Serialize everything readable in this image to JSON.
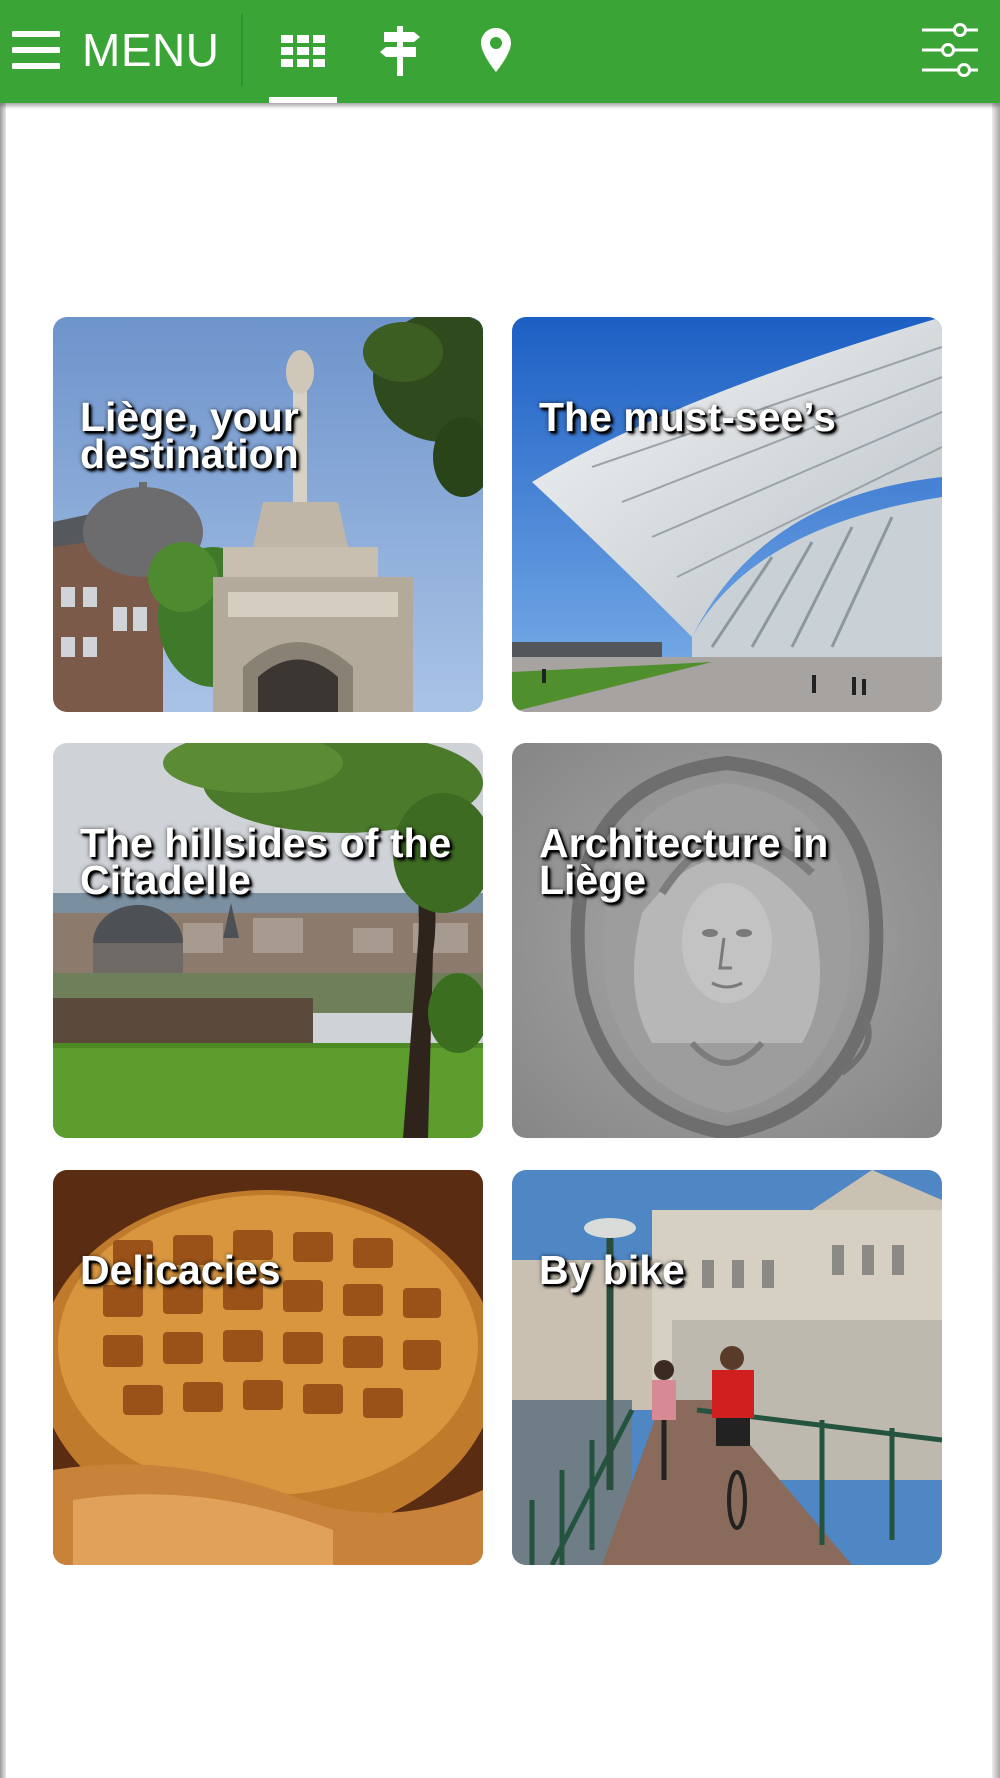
{
  "header": {
    "menu_label": "MENU",
    "tabs": [
      {
        "name": "grid-view",
        "icon": "grid-icon",
        "active": true
      },
      {
        "name": "routes",
        "icon": "signpost-icon",
        "active": false
      },
      {
        "name": "map",
        "icon": "map-pin-icon",
        "active": false
      }
    ],
    "filter_icon": "sliders-icon",
    "bar_color": "#3aa536"
  },
  "tiles": [
    {
      "title": "Liège, your destination"
    },
    {
      "title": "The must-see’s"
    },
    {
      "title": "The hillsides of the Citadelle"
    },
    {
      "title": "Architecture in Liège"
    },
    {
      "title": "Delicacies"
    },
    {
      "title": "By bike"
    }
  ]
}
